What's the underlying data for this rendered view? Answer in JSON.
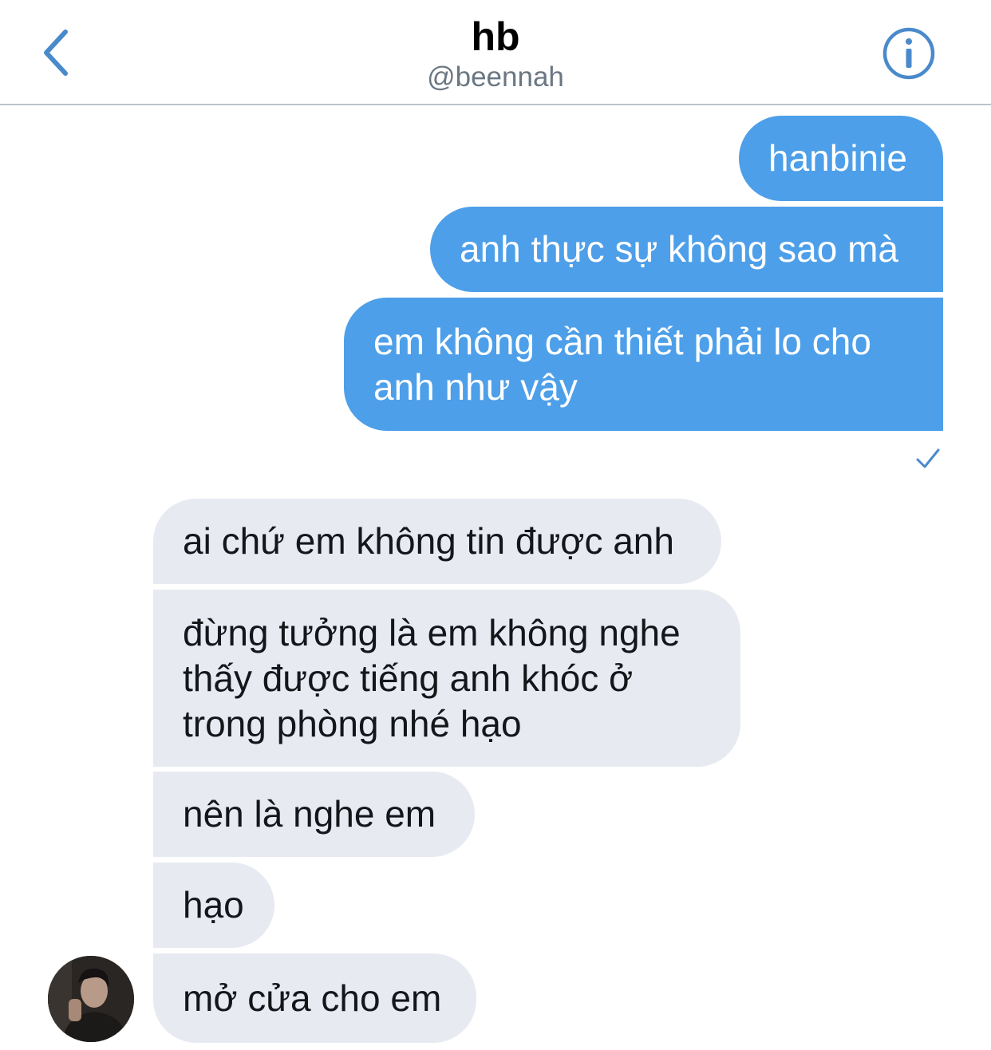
{
  "header": {
    "title": "hb",
    "handle": "@beennah",
    "accent_color": "#4a8acb",
    "back_icon": "chevron-left-icon",
    "info_icon": "info-circle-icon"
  },
  "colors": {
    "outgoing_bubble": "#4d9fe9",
    "incoming_bubble": "#e7eaf1"
  },
  "messages": [
    {
      "direction": "outgoing",
      "text": "hanbinie"
    },
    {
      "direction": "outgoing",
      "text": "anh thực sự không sao mà"
    },
    {
      "direction": "outgoing",
      "lines": [
        "em không cần thiết phải lo cho",
        "anh như vậy"
      ]
    },
    {
      "direction": "incoming",
      "text": "ai chứ em không tin được anh"
    },
    {
      "direction": "incoming",
      "lines": [
        "đừng tưởng là em không nghe",
        "thấy được tiếng anh khóc ở",
        "trong phòng nhé hạo"
      ]
    },
    {
      "direction": "incoming",
      "text": "nên là nghe em"
    },
    {
      "direction": "incoming",
      "text": "hạo"
    },
    {
      "direction": "incoming",
      "text": "mở cửa cho em"
    }
  ],
  "status": {
    "read_icon": "checkmark-icon"
  }
}
